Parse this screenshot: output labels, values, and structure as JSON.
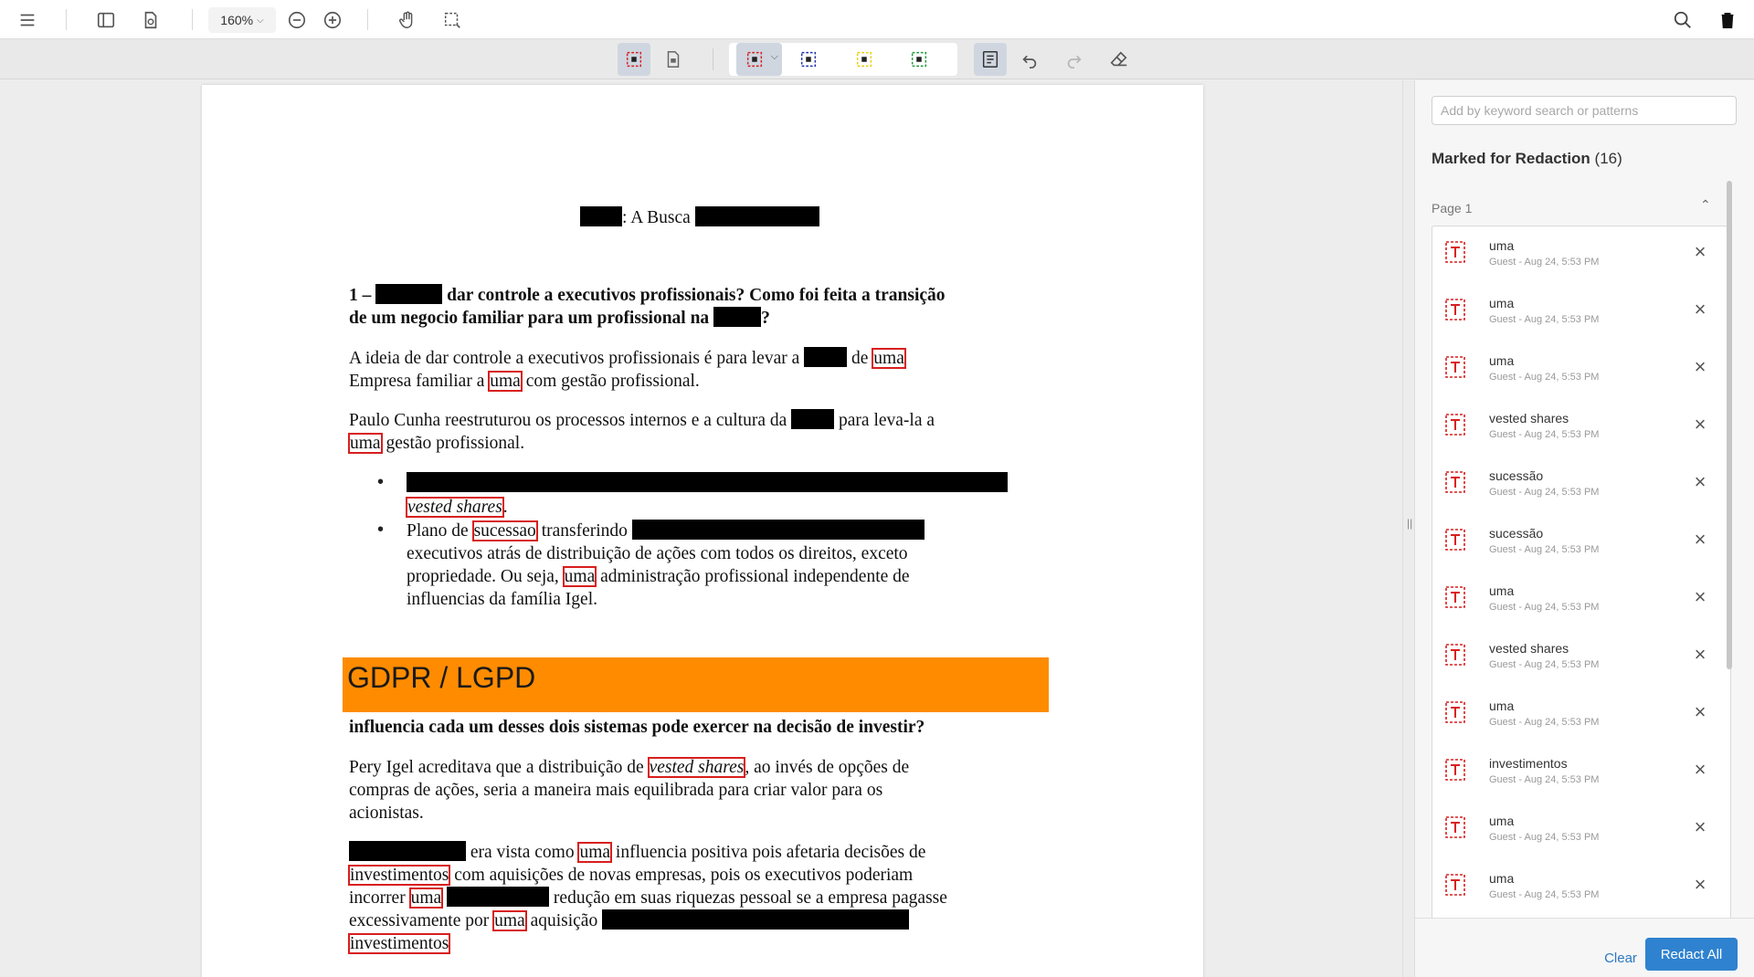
{
  "toolbar": {
    "zoom": "160%",
    "icons": [
      "menu-icon",
      "sidebar-icon",
      "file-settings-icon",
      "zoom-out-icon",
      "zoom-in-icon",
      "pan-hand-icon",
      "marquee-select-icon",
      "search-icon",
      "trash-icon"
    ]
  },
  "subtoolbar": {
    "icons": [
      "redact-area-icon",
      "redact-page-icon",
      "redact-text-icon",
      "redact-region-icon",
      "redact-highlight-icon",
      "redact-pattern-icon",
      "redaction-panel-icon",
      "undo-icon",
      "redo-icon",
      "eraser-icon"
    ]
  },
  "document": {
    "title": ": A Busca",
    "q1_prefix": "1 –",
    "q1_a": "dar controle a executivos profissionais? Como foi feita a transição",
    "q1_b": "de um negocio familiar para um profissional na",
    "q1_end": "?",
    "p1_a": "A ideia de dar controle a executivos profissionais é para  levar a",
    "p1_de": "de",
    "kw_uma": "uma",
    "p1_b": "Empresa familiar a",
    "p1_c": "com gestão profissional.",
    "p2_a": "Paulo Cunha reestruturou os processos internos e a cultura da",
    "p2_b": "para leva-la a",
    "p2_c": "gestão profissional.",
    "bullet_char": "•",
    "kw_vested": "vested shares",
    "b1_end": ".",
    "b2_a": "Plano de",
    "kw_sucessao": "sucessao",
    "b2_b": "transferindo",
    "b2_c": "executivos atrás de distribuição de ações com todos os direitos, exceto",
    "b2_d": "propriedade. Ou seja,",
    "b2_e": "administração profissional independente de",
    "b2_f": "influencias da família Igel.",
    "banner": "GDPR / LGPD",
    "q2": "influencia cada um desses dois sistemas pode exercer na decisão de investir?",
    "p3_a": "Pery Igel acreditava que a distribuição de",
    "p3_b": ", ao invés de opções de",
    "p3_c": "compras de ações, seria a maneira mais equilibrada para criar valor para os",
    "p3_d": "acionistas.",
    "p4_a": "era vista como",
    "p4_b": "influencia positiva pois afetaria decisões de",
    "kw_invest": "investimentos",
    "p4_c": "com aquisições de novas empresas, pois os executivos poderiam",
    "p4_d": "incorrer",
    "p4_e": "redução em suas riquezas pessoal se a empresa pagasse",
    "p4_f": "excessivamente por",
    "p4_g": "aquisição"
  },
  "panel": {
    "search_placeholder": "Add by keyword search or patterns",
    "marked_title": "Marked for Redaction",
    "marked_count": "(16)",
    "page_label": "Page 1",
    "items": [
      {
        "name": "uma",
        "meta": "Guest - Aug 24, 5:53 PM"
      },
      {
        "name": "uma",
        "meta": "Guest - Aug 24, 5:53 PM"
      },
      {
        "name": "uma",
        "meta": "Guest - Aug 24, 5:53 PM"
      },
      {
        "name": "vested shares",
        "meta": "Guest - Aug 24, 5:53 PM"
      },
      {
        "name": "sucessão",
        "meta": "Guest - Aug 24, 5:53 PM"
      },
      {
        "name": "sucessão",
        "meta": "Guest - Aug 24, 5:53 PM"
      },
      {
        "name": "uma",
        "meta": "Guest - Aug 24, 5:53 PM"
      },
      {
        "name": "vested shares",
        "meta": "Guest - Aug 24, 5:53 PM"
      },
      {
        "name": "uma",
        "meta": "Guest - Aug 24, 5:53 PM"
      },
      {
        "name": "investimentos",
        "meta": "Guest - Aug 24, 5:53 PM"
      },
      {
        "name": "uma",
        "meta": "Guest - Aug 24, 5:53 PM"
      },
      {
        "name": "uma",
        "meta": "Guest - Aug 24, 5:53 PM"
      }
    ],
    "clear_label": "Clear",
    "redact_all_label": "Redact All"
  },
  "colors": {
    "accent": "#2f82cf",
    "redaction_outline": "#d81e1e",
    "banner": "#ff8c00"
  }
}
